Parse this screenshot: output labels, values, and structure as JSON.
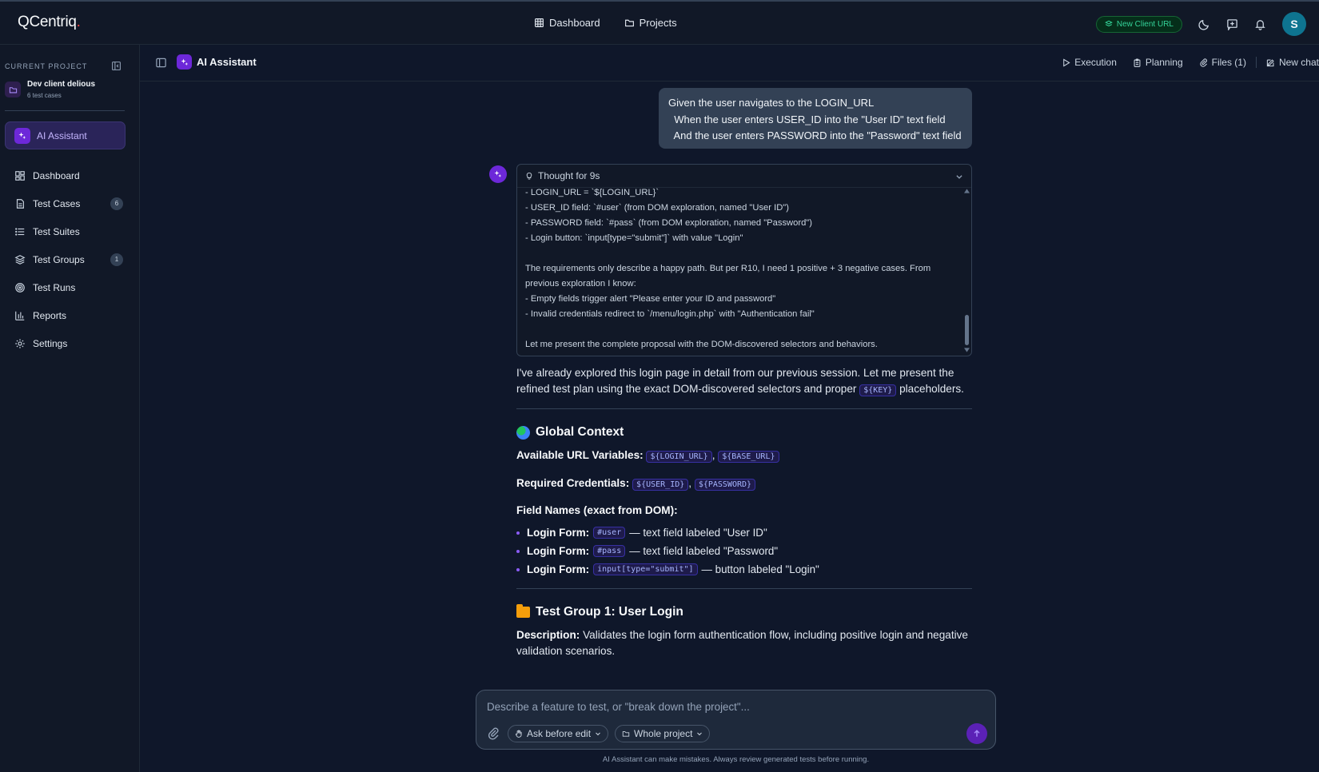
{
  "app": {
    "logo": "QCentriq",
    "logo_dot": "."
  },
  "topnav": {
    "dashboard": "Dashboard",
    "projects": "Projects"
  },
  "topbar": {
    "client_badge": "New Client URL",
    "avatar_letter": "S"
  },
  "sidebar": {
    "current_project_label": "CURRENT PROJECT",
    "project_name": "Dev client delious",
    "project_sub": "6 test cases",
    "active_item": "AI Assistant",
    "items": [
      {
        "label": "Dashboard",
        "icon": "dashboard-icon",
        "count": ""
      },
      {
        "label": "Test Cases",
        "icon": "document-icon",
        "count": "6"
      },
      {
        "label": "Test Suites",
        "icon": "list-icon",
        "count": ""
      },
      {
        "label": "Test Groups",
        "icon": "layers-icon",
        "count": "1"
      },
      {
        "label": "Test Runs",
        "icon": "target-icon",
        "count": ""
      },
      {
        "label": "Reports",
        "icon": "bar-chart-icon",
        "count": ""
      },
      {
        "label": "Settings",
        "icon": "gear-icon",
        "count": ""
      }
    ]
  },
  "subheader": {
    "title": "AI Assistant",
    "actions": {
      "execution": "Execution",
      "planning": "Planning",
      "files": "Files (1)",
      "new_chat": "New chat"
    }
  },
  "chat": {
    "user_message": "Given the user navigates to the LOGIN_URL\n  When the user enters USER_ID into the \"User ID\" text field\n  And the user enters PASSWORD into the \"Password\" text field",
    "thought_title": "Thought for 9s",
    "thought_lines": [
      "- LOGIN_URL = `${LOGIN_URL}`",
      "- USER_ID field: `#user` (from DOM exploration, named \"User ID\")",
      "- PASSWORD field: `#pass` (from DOM exploration, named \"Password\")",
      "- Login button: `input[type=\"submit\"]` with value \"Login\"",
      "",
      "The requirements only describe a happy path. But per R10, I need 1 positive + 3 negative cases. From",
      "previous exploration I know:",
      "- Empty fields trigger alert \"Please enter your ID and password\"",
      "- Invalid credentials redirect to `/menu/login.php` with \"Authentication fail\"",
      "",
      "Let me present the complete proposal with the DOM-discovered selectors and behaviors."
    ],
    "intro_1": "I've already explored this login page in detail from our previous session. Let me present the",
    "intro_2": "refined test plan using the exact DOM-discovered selectors and proper",
    "intro_code": "${KEY}",
    "intro_end": "placeholders.",
    "global": {
      "heading": "Global Context",
      "url_label": "Available URL Variables:",
      "url_vars": [
        "${LOGIN_URL}",
        "${BASE_URL}"
      ],
      "cred_label": "Required Credentials:",
      "creds": [
        "${USER_ID}",
        "${PASSWORD}"
      ],
      "fields_label": "Field Names (exact from DOM):",
      "fields": [
        {
          "label": "Login Form:",
          "code": "#user",
          "desc": "— text field labeled \"User ID\""
        },
        {
          "label": "Login Form:",
          "code": "#pass",
          "desc": "— text field labeled \"Password\""
        },
        {
          "label": "Login Form:",
          "code": "input[type=\"submit\"]",
          "desc": "— button labeled \"Login\""
        }
      ]
    },
    "group": {
      "heading": "Test Group 1: User Login",
      "desc_label": "Description:",
      "desc_1": "Validates the login form authentication flow, including positive login and negative",
      "desc_2": "validation scenarios."
    }
  },
  "composer": {
    "placeholder": "Describe a feature to test, or \"break down the project\"...",
    "mode": "Ask before edit",
    "scope": "Whole project",
    "disclaimer": "AI Assistant can make mistakes. Always review generated tests before running."
  }
}
